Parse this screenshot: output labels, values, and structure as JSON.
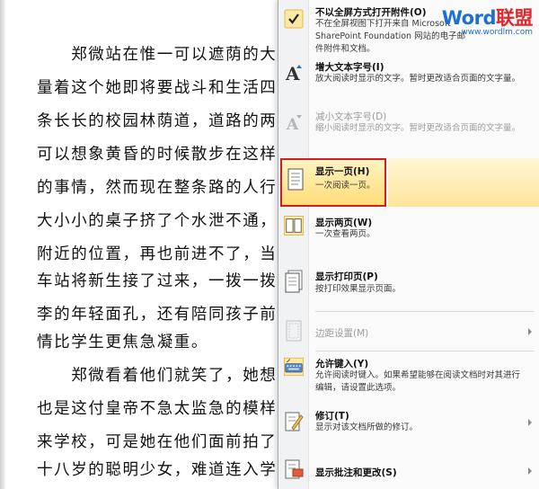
{
  "document": {
    "lines": [
      "　　郑微站在惟一可以遮荫的大树",
      "量着这个她即将要战斗和生活四年",
      "条长长的校园林荫道，道路的两边是",
      "可以想象黄昏的时候散步在这样一",
      "的事情，然而现在整条路的人行道",
      "大小小的桌子挤了个水泄不通，不",
      "附近的位置，再也前进不了，当然",
      "车站将新生接了过来，一拨一拨的",
      "李的年轻面孔，还有陪同孩子前来",
      "情比学生更焦急凝重。",
      "　　郑微看着他们就笑了，她想，",
      "也是这付皇帝不急太监急的模样吧",
      "来学校，可是她在他们面前拍了胸脯",
      "十八岁的聪明少女，难道连入学报"
    ]
  },
  "watermark": {
    "brand_a": "Word",
    "brand_b": "联盟",
    "url": "www.wordlm.com"
  },
  "menu": {
    "items": [
      {
        "id": "open-attachments",
        "title": "不以全屏方式打开附件(O)",
        "desc": "不在全屏视图下打开来自 Microsoft SharePoint Foundation 网站的电子邮件附件和文档。",
        "icon": "checkmark-icon"
      },
      {
        "id": "increase-font",
        "title": "增大文本字号(I)",
        "desc": "放大阅读时显示的文字。暂时更改适合页面的文字量。",
        "icon": "increase-font-icon"
      },
      {
        "id": "decrease-font",
        "title": "减小文本字号(D)",
        "desc": "缩小阅读时显示的文字。暂时更改适合页面的文字量。",
        "icon": "decrease-font-icon"
      },
      {
        "id": "show-one-page",
        "title": "显示一页(H)",
        "desc": "一次阅读一页。",
        "icon": "one-page-icon"
      },
      {
        "id": "show-two-pages",
        "title": "显示两页(W)",
        "desc": "一次查看两页。",
        "icon": "two-pages-icon"
      },
      {
        "id": "show-printed-page",
        "title": "显示打印页(P)",
        "desc": "按打印效果显示页面。",
        "icon": "printed-page-icon"
      },
      {
        "id": "margin-settings",
        "title": "边距设置(M)",
        "desc": "",
        "icon": "margin-settings-icon"
      },
      {
        "id": "allow-typing",
        "title": "允许键入(Y)",
        "desc": "允许阅读时键入。如果希望能够在阅读文档时对其进行编辑，请设置此选项。",
        "icon": "keyboard-icon"
      },
      {
        "id": "track-changes",
        "title": "修订(T)",
        "desc": "显示对该文档所做的修订。",
        "icon": "track-changes-icon"
      },
      {
        "id": "show-comments",
        "title": "显示批注和更改(S)",
        "desc": "",
        "icon": "comments-icon"
      }
    ]
  },
  "colors": {
    "selected_border": "#d31d20",
    "highlight": "#ffdd78",
    "brand_blue": "#1e6fd2",
    "brand_red": "#e3262a"
  }
}
